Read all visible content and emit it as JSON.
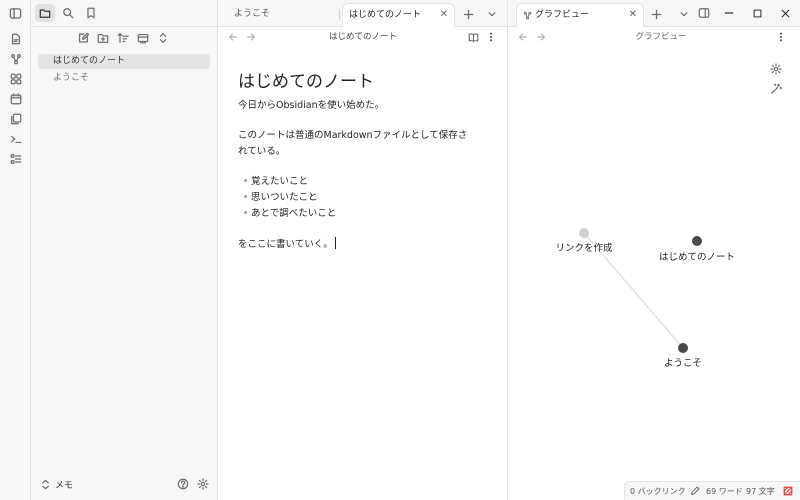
{
  "ribbon": {
    "icons": [
      "sidebar-toggle-icon",
      "new-note-icon",
      "graph-icon",
      "canvas-icon",
      "calendar-icon",
      "templates-icon",
      "command-palette-icon",
      "bases-icon"
    ]
  },
  "sidebar": {
    "header_icons": [
      "files-icon",
      "search-icon",
      "bookmark-icon"
    ],
    "toolbar_icons": [
      "new-note-icon",
      "new-folder-icon",
      "sort-icon",
      "collapse-icon",
      "expand-icon"
    ],
    "files": [
      {
        "label": "はじめてのノート",
        "active": true
      },
      {
        "label": "ようこそ",
        "active": false
      }
    ],
    "vault_name": "メモ"
  },
  "editor_tabs": [
    {
      "label": "ようこそ",
      "active": false
    },
    {
      "label": "はじめてのノート",
      "active": true
    }
  ],
  "editor": {
    "view_title": "はじめてのノート",
    "title": "はじめてのノート",
    "line1": "今日からObsidianを使い始めた。",
    "line2a": "このノートは普通のMarkdownファイルとして保存さ",
    "line2b": "れている。",
    "bullets": [
      "覚えたいこと",
      "思いついたこと",
      "あとで調べたいこと"
    ],
    "line3": "をここに書いていく。"
  },
  "graph_tab": {
    "label": "グラフビュー"
  },
  "graph": {
    "view_title": "グラフビュー",
    "nodes": [
      {
        "label": "リンクを作成",
        "color": "#d0d0d0"
      },
      {
        "label": "はじめてのノート",
        "color": "#4a4a4a"
      },
      {
        "label": "ようこそ",
        "color": "#4a4a4a"
      }
    ]
  },
  "status": {
    "backlinks": "0 バックリンク",
    "words": "69 ワード",
    "chars": "97 文字"
  },
  "colors": {
    "panel_bg": "#f6f6f6",
    "border": "#e3e3e3",
    "active_file_bg": "#e4e4e4",
    "sync_status": "#e0443c"
  }
}
